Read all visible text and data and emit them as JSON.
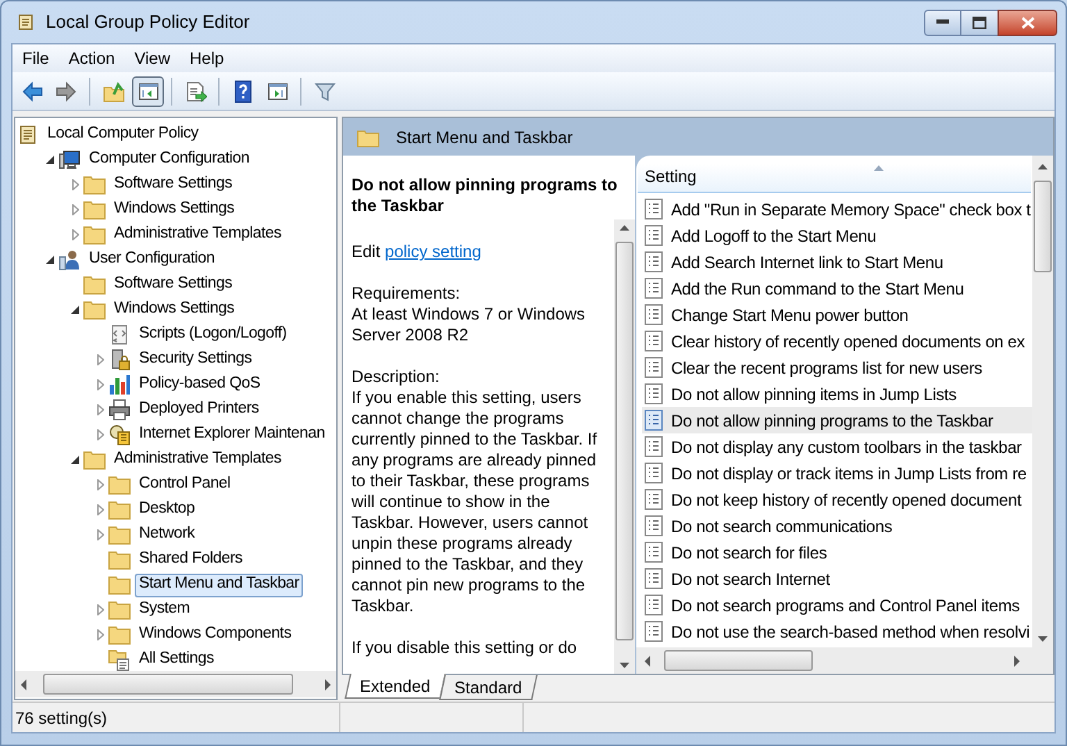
{
  "window": {
    "title": "Local Group Policy Editor"
  },
  "menu": [
    "File",
    "Action",
    "View",
    "Help"
  ],
  "toolbar": [
    {
      "kind": "back",
      "pressed": false
    },
    {
      "kind": "forward",
      "pressed": false
    },
    {
      "kind": "sep"
    },
    {
      "kind": "up",
      "pressed": false
    },
    {
      "kind": "tree",
      "pressed": true
    },
    {
      "kind": "sep"
    },
    {
      "kind": "export",
      "pressed": false
    },
    {
      "kind": "sep"
    },
    {
      "kind": "help",
      "pressed": false
    },
    {
      "kind": "pane",
      "pressed": false
    },
    {
      "kind": "sep"
    },
    {
      "kind": "filter",
      "pressed": false
    }
  ],
  "tree": {
    "label": "Local Computer Policy",
    "kind": "policy",
    "selected": false,
    "children": [
      {
        "label": "Computer Configuration",
        "kind": "computer",
        "selected": false,
        "expanded": true,
        "children": [
          {
            "label": "Software Settings",
            "kind": "folder",
            "selected": false,
            "expanded": false
          },
          {
            "label": "Windows Settings",
            "kind": "folder",
            "selected": false,
            "expanded": false
          },
          {
            "label": "Administrative Templates",
            "kind": "folder",
            "selected": false,
            "expanded": false
          }
        ]
      },
      {
        "label": "User Configuration",
        "kind": "user",
        "selected": false,
        "expanded": true,
        "children": [
          {
            "label": "Software Settings",
            "kind": "folder",
            "selected": false
          },
          {
            "label": "Windows Settings",
            "kind": "folder",
            "selected": false,
            "expanded": true,
            "children": [
              {
                "label": "Scripts (Logon/Logoff)",
                "kind": "script",
                "selected": false
              },
              {
                "label": "Security Settings",
                "kind": "security",
                "selected": false,
                "expanded": false
              },
              {
                "label": "Policy-based QoS",
                "kind": "chart",
                "selected": false,
                "expanded": false
              },
              {
                "label": "Deployed Printers",
                "kind": "printer",
                "selected": false,
                "expanded": false
              },
              {
                "label": "Internet Explorer Maintenan",
                "kind": "browser",
                "selected": false,
                "expanded": false
              }
            ]
          },
          {
            "label": "Administrative Templates",
            "kind": "folder",
            "selected": false,
            "expanded": true,
            "children": [
              {
                "label": "Control Panel",
                "kind": "folder",
                "selected": false,
                "expanded": false
              },
              {
                "label": "Desktop",
                "kind": "folder",
                "selected": false,
                "expanded": false
              },
              {
                "label": "Network",
                "kind": "folder",
                "selected": false,
                "expanded": false
              },
              {
                "label": "Shared Folders",
                "kind": "folder",
                "selected": false
              },
              {
                "label": "Start Menu and Taskbar",
                "kind": "folder",
                "selected": true
              },
              {
                "label": "System",
                "kind": "folder",
                "selected": false,
                "expanded": false
              },
              {
                "label": "Windows Components",
                "kind": "folder",
                "selected": false,
                "expanded": false
              },
              {
                "label": "All Settings",
                "kind": "allsettings",
                "selected": false
              }
            ]
          }
        ]
      }
    ]
  },
  "details": {
    "header": "Start Menu and Taskbar",
    "policy_title": "Do not allow pinning programs to the Taskbar",
    "edit_prefix": "Edit",
    "edit_link": "policy setting",
    "requirements_label": "Requirements:",
    "requirements": "At least Windows 7 or Windows Server 2008 R2",
    "description_label": "Description:",
    "description": [
      "If you enable this setting, users cannot change the programs currently pinned to the Taskbar. If any programs are already pinned to their Taskbar, these programs will continue to show in the Taskbar. However, users cannot unpin these programs already pinned to the Taskbar, and they cannot pin new programs to the Taskbar.",
      "If you disable this setting or do"
    ]
  },
  "settings": {
    "column": "Setting",
    "rows": [
      {
        "label": "Add \"Run in Separate Memory Space\" check box t",
        "selected": false
      },
      {
        "label": "Add Logoff to the Start Menu",
        "selected": false
      },
      {
        "label": "Add Search Internet link to Start Menu",
        "selected": false
      },
      {
        "label": "Add the Run command to the Start Menu",
        "selected": false
      },
      {
        "label": "Change Start Menu power button",
        "selected": false
      },
      {
        "label": "Clear history of recently opened documents on ex",
        "selected": false
      },
      {
        "label": "Clear the recent programs list for new users",
        "selected": false
      },
      {
        "label": "Do not allow pinning items in Jump Lists",
        "selected": false
      },
      {
        "label": "Do not allow pinning programs to the Taskbar",
        "selected": true
      },
      {
        "label": "Do not display any custom toolbars in the taskbar",
        "selected": false
      },
      {
        "label": "Do not display or track items in Jump Lists from re",
        "selected": false
      },
      {
        "label": "Do not keep history of recently opened document",
        "selected": false
      },
      {
        "label": "Do not search communications",
        "selected": false
      },
      {
        "label": "Do not search for files",
        "selected": false
      },
      {
        "label": "Do not search Internet",
        "selected": false
      },
      {
        "label": "Do not search programs and Control Panel items",
        "selected": false
      },
      {
        "label": "Do not use the search-based method when resolvi",
        "selected": false
      }
    ]
  },
  "tabs": [
    {
      "label": "Extended",
      "selected": true
    },
    {
      "label": "Standard",
      "selected": false
    }
  ],
  "status_bar": "76 setting(s)"
}
